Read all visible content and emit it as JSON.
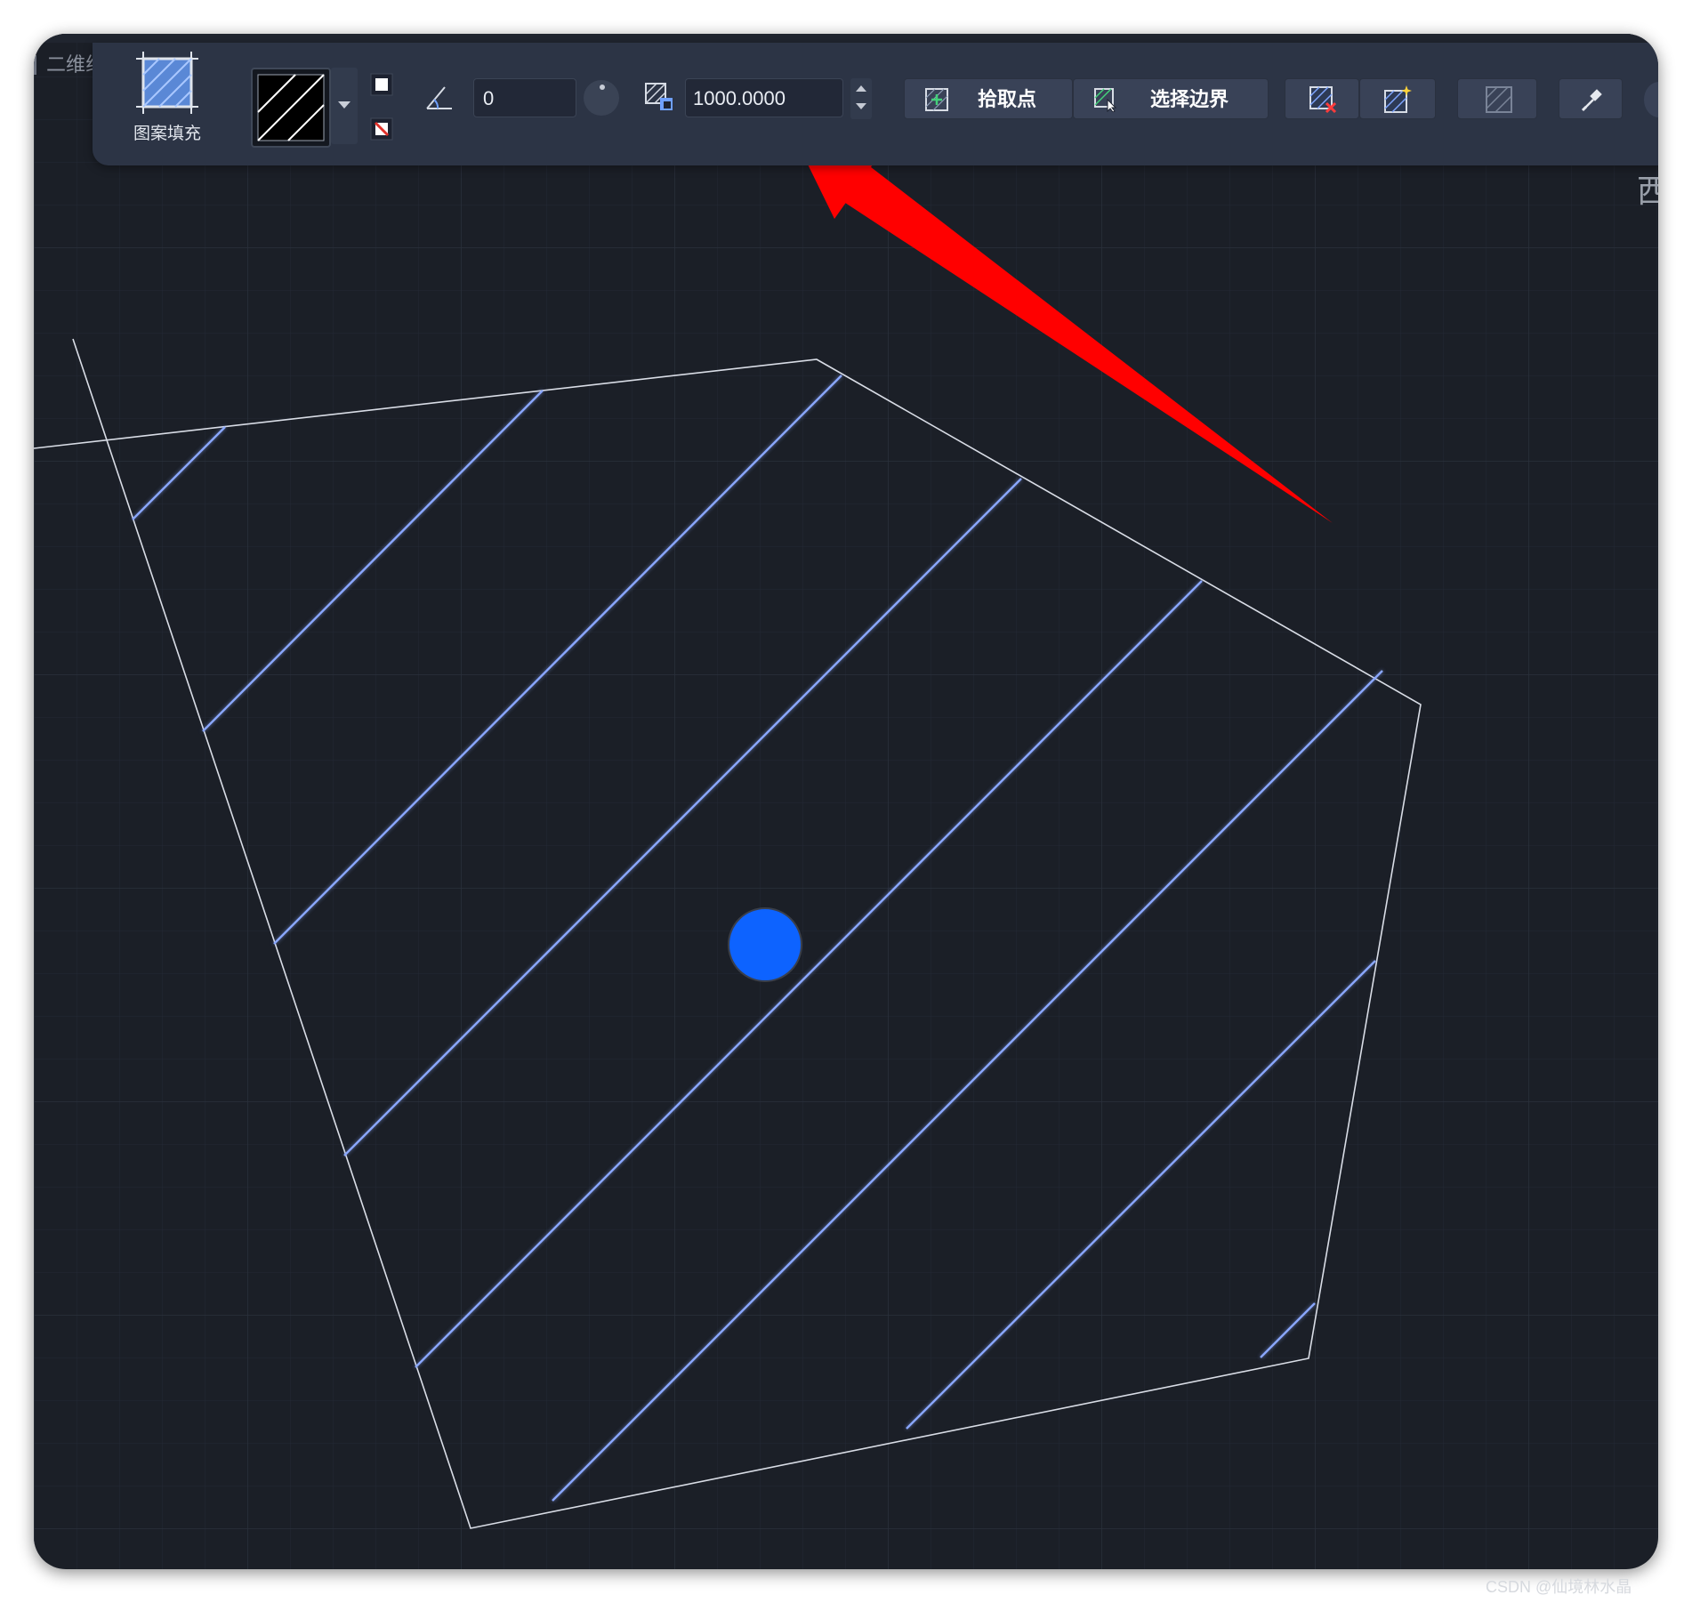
{
  "view_tab": {
    "label": "二维线"
  },
  "toolbar": {
    "hatch_tool_label": "图案填充",
    "angle_value": "0",
    "scale_value": "1000.0000",
    "pick_points_label": "拾取点",
    "select_boundary_label": "选择边界"
  },
  "side_glyph": "西",
  "watermark": "CSDN @仙境林水晶",
  "icons": [
    "hatch-pattern-icon",
    "angle-icon",
    "scale-icon",
    "pick-points-icon",
    "select-boundary-icon",
    "remove-boundary-icon",
    "recreate-boundary-icon",
    "hatch-display-icon",
    "eyedropper-icon"
  ],
  "colors": {
    "canvas_background": "#1b1f27",
    "toolbar_background": "#2c3445",
    "hatch_line": "#8aa7ff",
    "boundary_line": "#d9dde6",
    "center_marker": "#0d63ff",
    "annotation_arrow": "#ff0000"
  }
}
